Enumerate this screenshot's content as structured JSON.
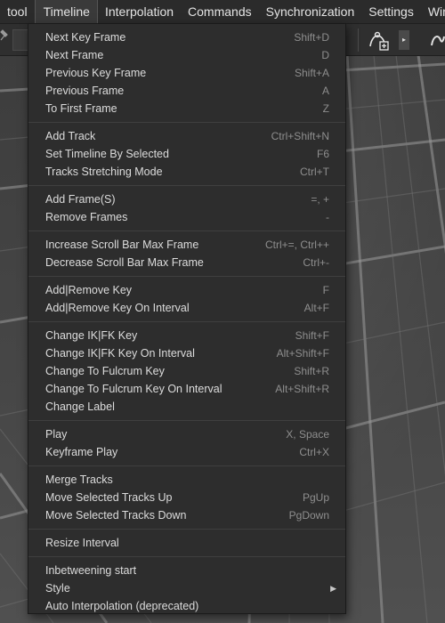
{
  "menubar": {
    "items": [
      {
        "label": "tool",
        "active": false
      },
      {
        "label": "Timeline",
        "active": true
      },
      {
        "label": "Interpolation",
        "active": false
      },
      {
        "label": "Commands",
        "active": false
      },
      {
        "label": "Synchronization",
        "active": false
      },
      {
        "label": "Settings",
        "active": false
      },
      {
        "label": "Windo",
        "active": false
      }
    ]
  },
  "toolbar": {
    "icons": [
      "pin-icon",
      "node-add-icon",
      "expand-arrow-icon",
      "curve-icon"
    ]
  },
  "timeline_menu": {
    "groups": [
      [
        {
          "label": "Next Key Frame",
          "shortcut": "Shift+D"
        },
        {
          "label": "Next Frame",
          "shortcut": "D"
        },
        {
          "label": "Previous Key Frame",
          "shortcut": "Shift+A"
        },
        {
          "label": "Previous Frame",
          "shortcut": "A"
        },
        {
          "label": "To First Frame",
          "shortcut": "Z"
        }
      ],
      [
        {
          "label": "Add Track",
          "shortcut": "Ctrl+Shift+N"
        },
        {
          "label": "Set Timeline By Selected",
          "shortcut": "F6"
        },
        {
          "label": "Tracks Stretching Mode",
          "shortcut": "Ctrl+T"
        }
      ],
      [
        {
          "label": "Add Frame(S)",
          "shortcut": "=, +"
        },
        {
          "label": "Remove Frames",
          "shortcut": "-"
        }
      ],
      [
        {
          "label": "Increase Scroll Bar Max Frame",
          "shortcut": "Ctrl+=, Ctrl++"
        },
        {
          "label": "Decrease Scroll Bar Max Frame",
          "shortcut": "Ctrl+-"
        }
      ],
      [
        {
          "label": "Add|Remove Key",
          "shortcut": "F"
        },
        {
          "label": "Add|Remove Key On Interval",
          "shortcut": "Alt+F"
        }
      ],
      [
        {
          "label": "Change IK|FK Key",
          "shortcut": "Shift+F"
        },
        {
          "label": "Change IK|FK Key On Interval",
          "shortcut": "Alt+Shift+F"
        },
        {
          "label": "Change To Fulcrum Key",
          "shortcut": "Shift+R"
        },
        {
          "label": "Change To Fulcrum Key On Interval",
          "shortcut": "Alt+Shift+R"
        },
        {
          "label": "Change Label",
          "shortcut": ""
        }
      ],
      [
        {
          "label": "Play",
          "shortcut": "X, Space"
        },
        {
          "label": "Keyframe Play",
          "shortcut": "Ctrl+X"
        }
      ],
      [
        {
          "label": "Merge Tracks",
          "shortcut": ""
        },
        {
          "label": "Move Selected Tracks Up",
          "shortcut": "PgUp"
        },
        {
          "label": "Move Selected Tracks Down",
          "shortcut": "PgDown"
        }
      ],
      [
        {
          "label": "Resize Interval",
          "shortcut": ""
        }
      ],
      [
        {
          "label": "Inbetweening start",
          "shortcut": ""
        },
        {
          "label": "Style",
          "shortcut": "",
          "submenu": true
        },
        {
          "label": "Auto Interpolation (deprecated)",
          "shortcut": ""
        }
      ]
    ]
  }
}
